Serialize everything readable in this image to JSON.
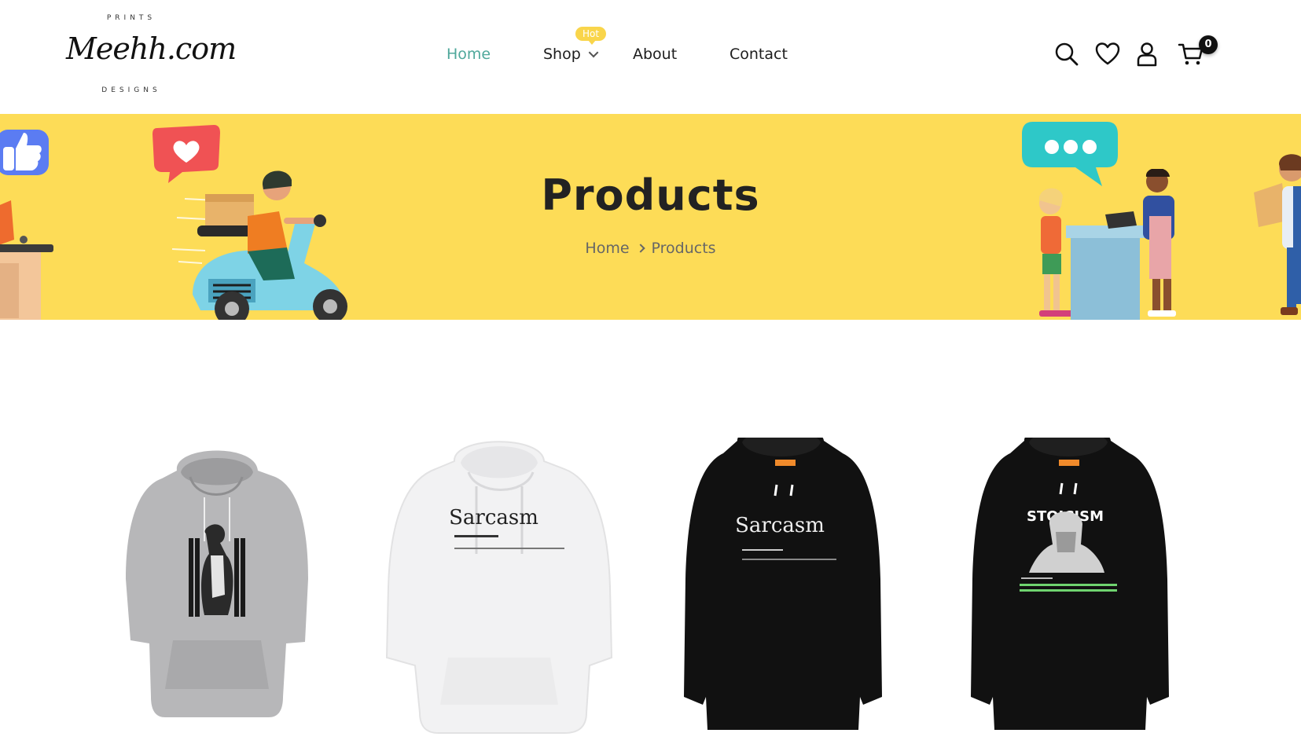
{
  "brand": {
    "top_text": "PRINTS",
    "script_text": "Meehh.com",
    "bottom_text": "DESIGNS"
  },
  "nav": {
    "items": [
      {
        "label": "Home",
        "active": true
      },
      {
        "label": "Shop",
        "badge": "Hot"
      },
      {
        "label": "About"
      },
      {
        "label": "Contact"
      }
    ]
  },
  "header_icons": {
    "icons": [
      "search-icon",
      "heart-icon",
      "user-icon",
      "cart-icon"
    ],
    "cart_count": "0"
  },
  "banner": {
    "title": "Products",
    "breadcrumb": [
      "Home",
      "Products"
    ],
    "background": "#fddc57"
  },
  "products": [
    {
      "color": "grey",
      "print": ""
    },
    {
      "color": "white",
      "print": "Sarcasm"
    },
    {
      "color": "black",
      "print": "Sarcasm"
    },
    {
      "color": "black",
      "print": "STOICISM"
    }
  ],
  "colors": {
    "accent": "#4fa89b",
    "badge": "#f9d54b"
  }
}
